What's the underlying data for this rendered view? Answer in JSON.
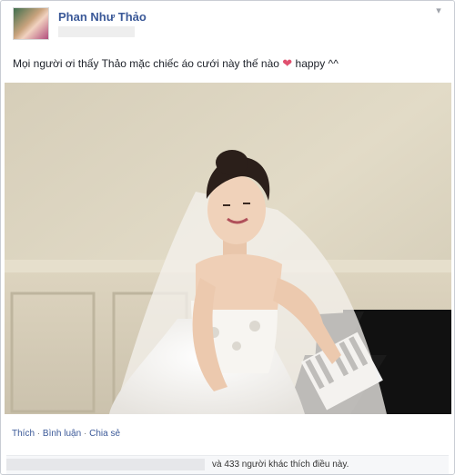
{
  "post": {
    "author": "Phan Như Thảo",
    "text_before": "Mọi người ơi thấy Thảo mặc chiếc áo cưới này thế nào",
    "heart_icon": "heart-emoji",
    "text_after": "happy ^^"
  },
  "actions": {
    "like": "Thích",
    "comment": "Bình luận",
    "share": "Chia sẻ",
    "separator": "·"
  },
  "likes": {
    "summary": "và 433 người khác thích điều này."
  }
}
